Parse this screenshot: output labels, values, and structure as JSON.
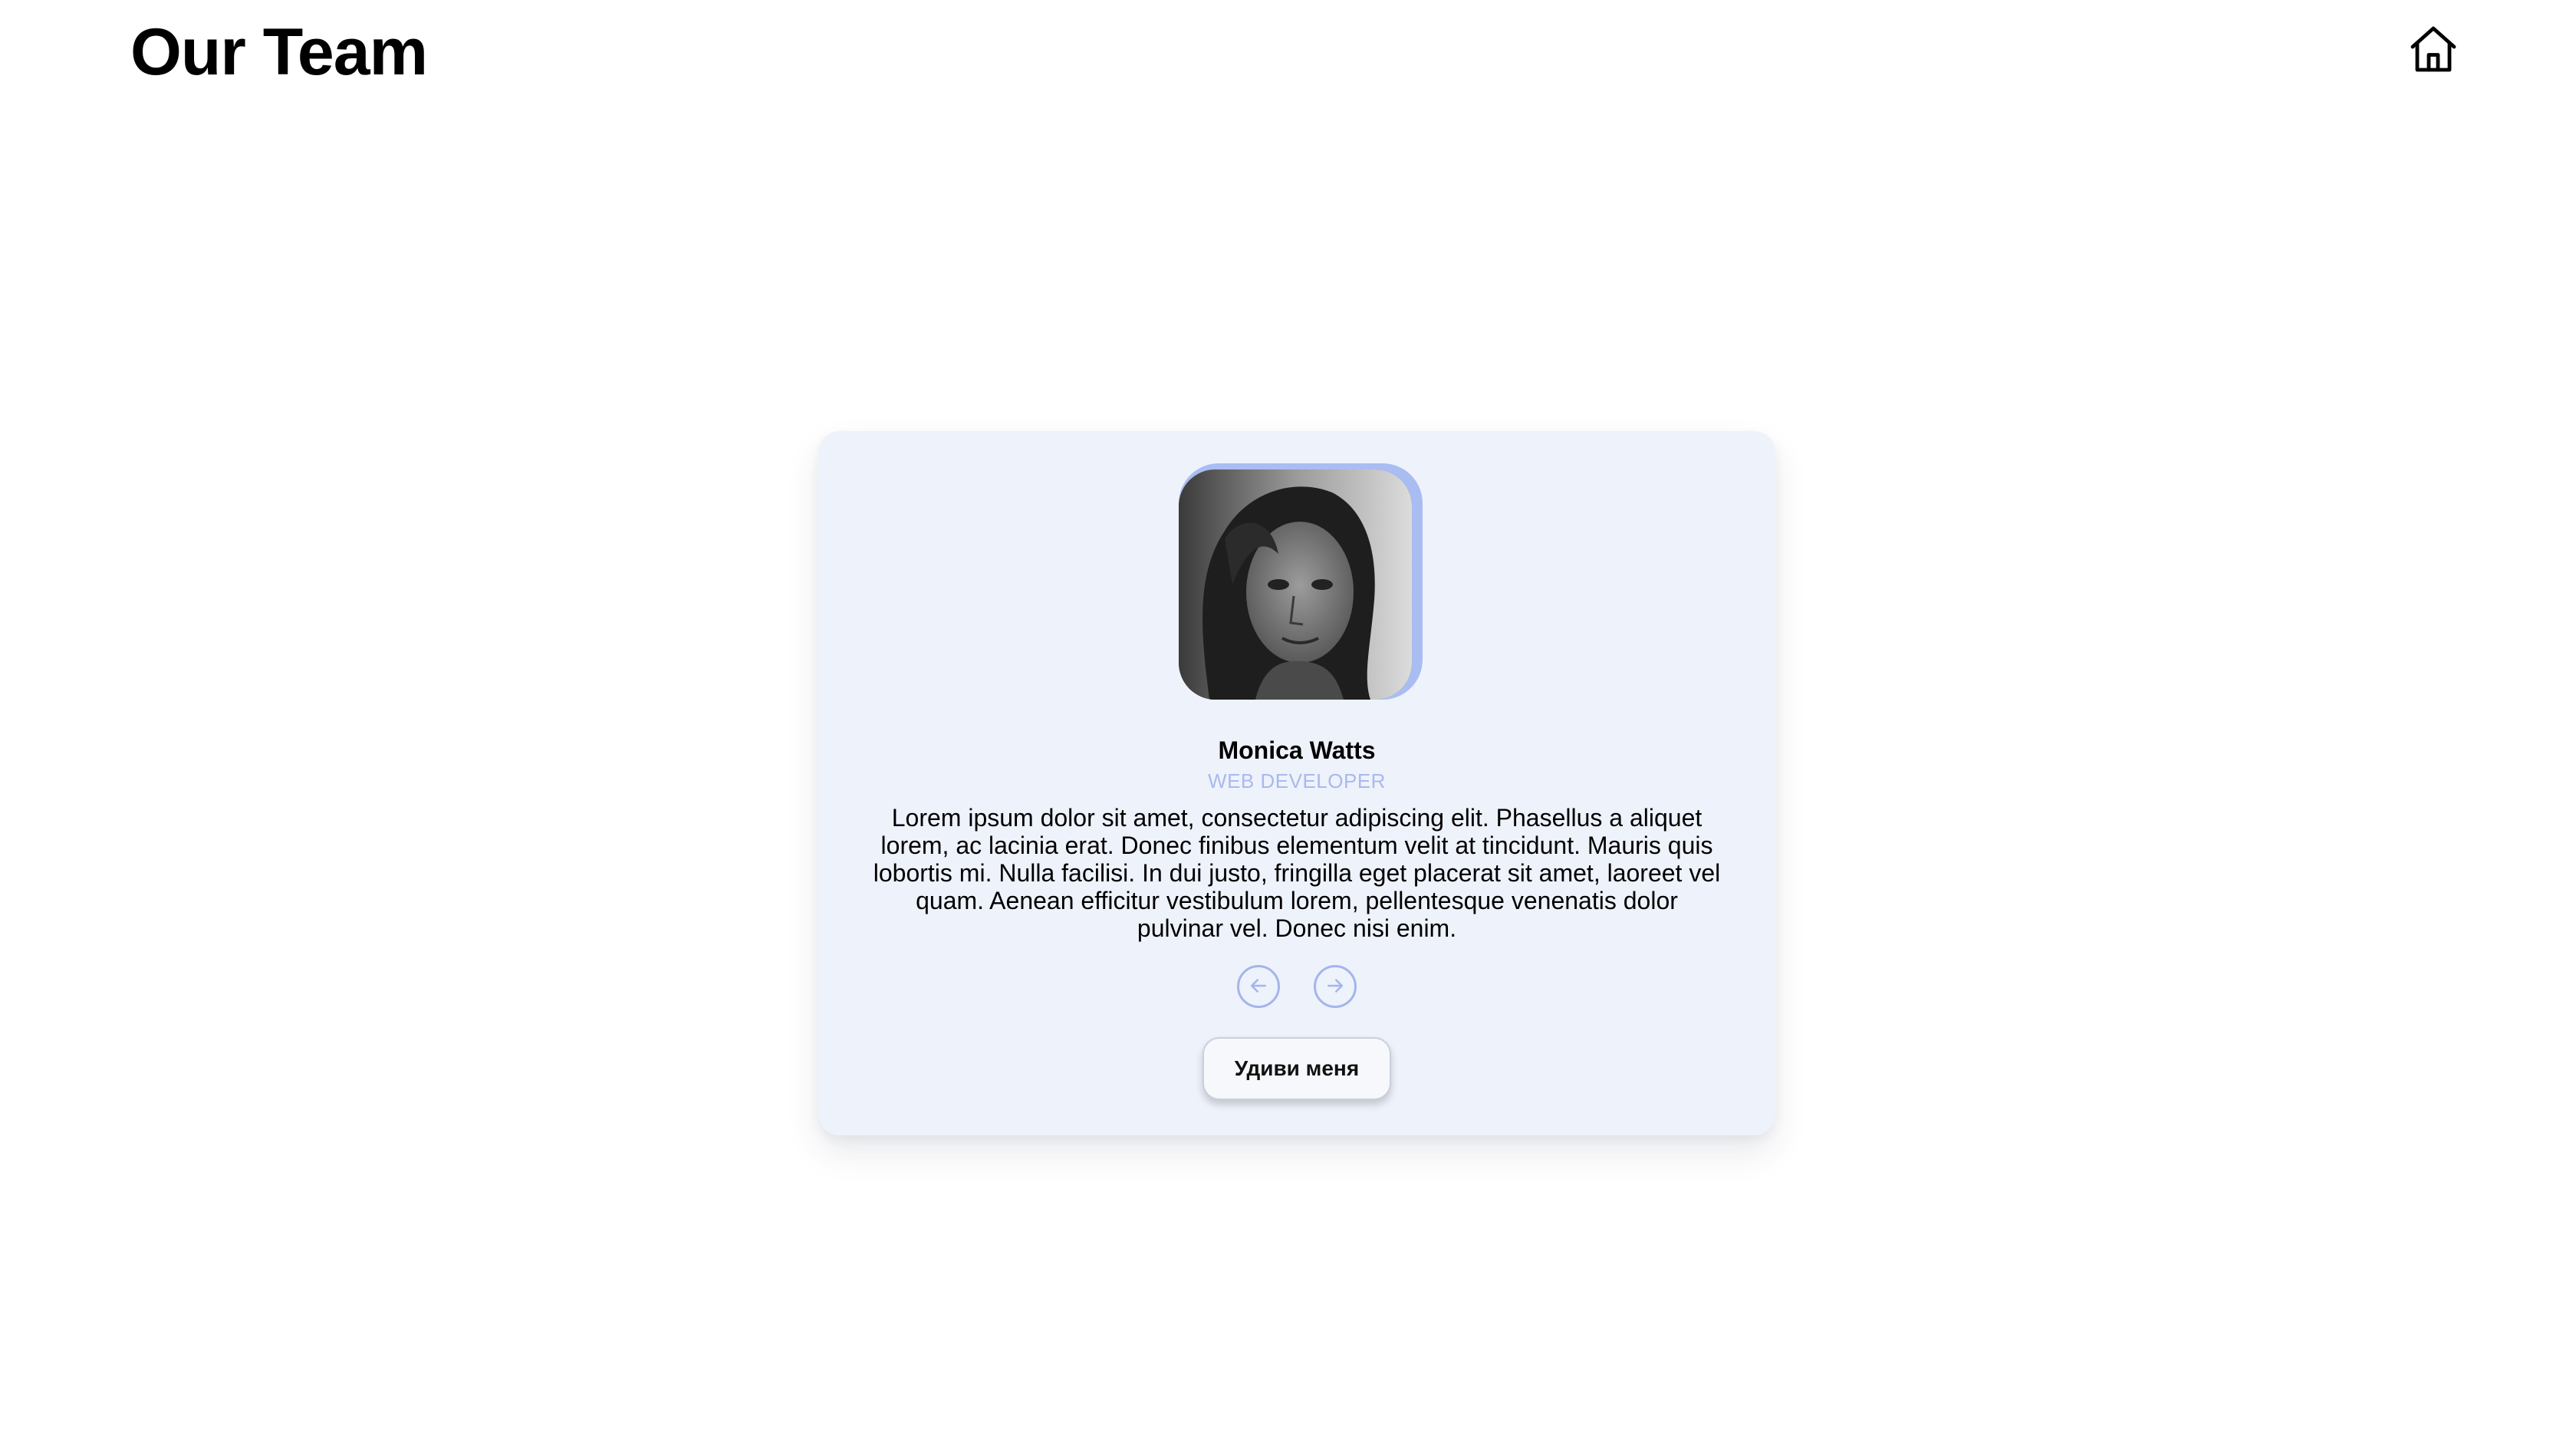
{
  "header": {
    "title": "Our Team",
    "home_icon": "home-icon"
  },
  "card": {
    "name": "Monica Watts",
    "role": "WEB DEVELOPER",
    "bio": "Lorem ipsum dolor sit amet, consectetur adipiscing elit. Phasellus a aliquet lorem, ac lacinia erat. Donec finibus elementum velit at tincidunt. Mauris quis lobortis mi. Nulla facilisi. In dui justo, fringilla eget placerat sit amet, laoreet vel quam. Aenean efficitur vestibulum lorem, pellentesque venenatis dolor pulvinar vel. Donec nisi enim.",
    "prev_icon": "arrow-left-circle-icon",
    "next_icon": "arrow-right-circle-icon",
    "surprise_label": "Удиви меня"
  },
  "colors": {
    "card_background": "#eef2fb",
    "accent": "#a9bdf2",
    "role_text": "#a9b9ee"
  }
}
